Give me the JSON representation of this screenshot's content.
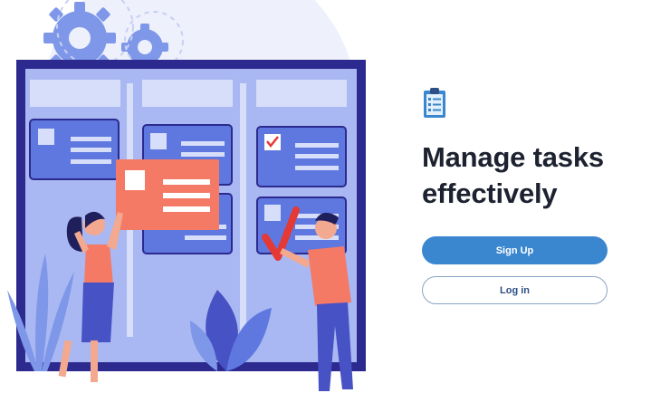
{
  "headline": {
    "line1": "Manage tasks",
    "line2": "effectively"
  },
  "actions": {
    "signup_label": "Sign Up",
    "login_label": "Log in"
  },
  "icons": {
    "app": "clipboard-checklist-icon"
  },
  "colors": {
    "primary_button": "#3a86cf",
    "headline_text": "#1d2230",
    "secondary_button_text": "#2d4f86",
    "board_frame": "#2c2a8f",
    "board_fill": "#a9b8f2",
    "accent_salmon": "#f47a66"
  }
}
